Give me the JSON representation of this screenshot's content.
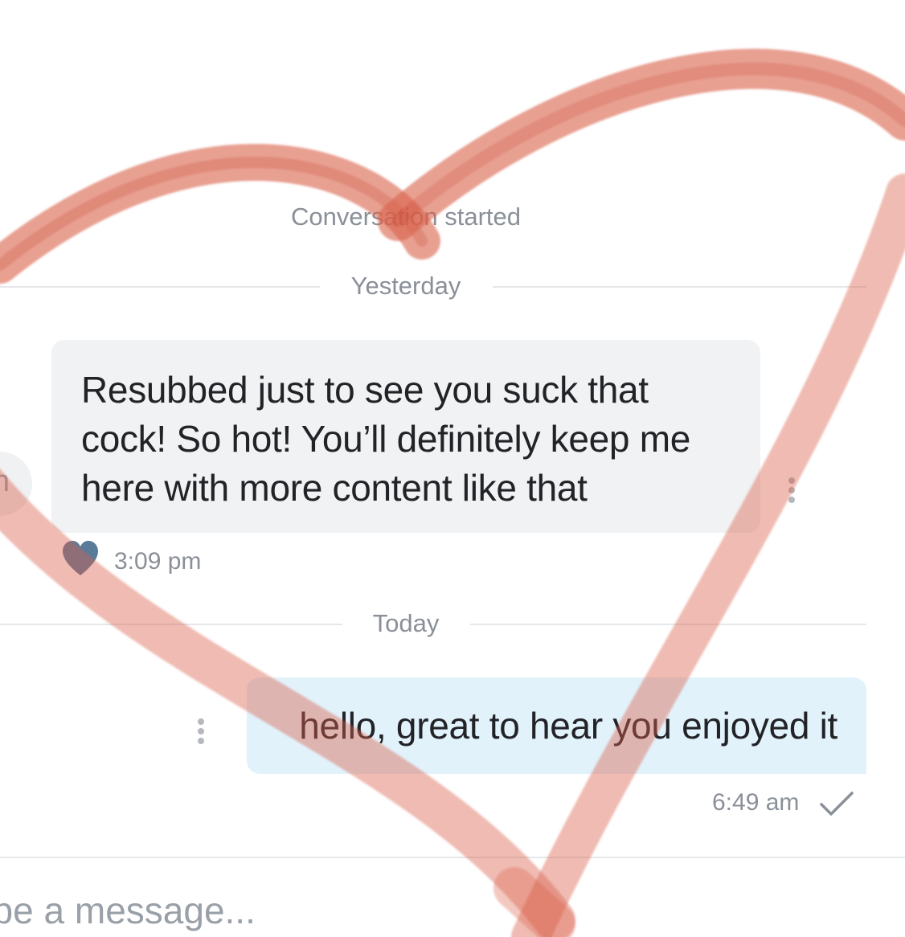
{
  "conversation": {
    "started_label": "Conversation started",
    "dividers": {
      "yesterday": "Yesterday",
      "today": "Today"
    },
    "incoming_message": {
      "text": "Resubbed just to see you suck that cock! So hot! You’ll definitely keep me here with more content like that",
      "time": "3:09 pm",
      "liked": true,
      "like_icon": "heart-icon"
    },
    "outgoing_message": {
      "text": "hello, great to hear you enjoyed it",
      "time": "6:49 am",
      "status_icon": "check-icon"
    },
    "avatar_initial": "n"
  },
  "composer": {
    "placeholder": "Type a message..."
  },
  "colors": {
    "incoming_bubble": "#f1f2f4",
    "outgoing_bubble": "#e2f2fb",
    "like_heart": "#5a7a99",
    "overlay_heart": "#d9604a"
  },
  "icons": {
    "message_options": "more-vertical-icon",
    "overlay_drawing": "drawn-heart-icon"
  }
}
